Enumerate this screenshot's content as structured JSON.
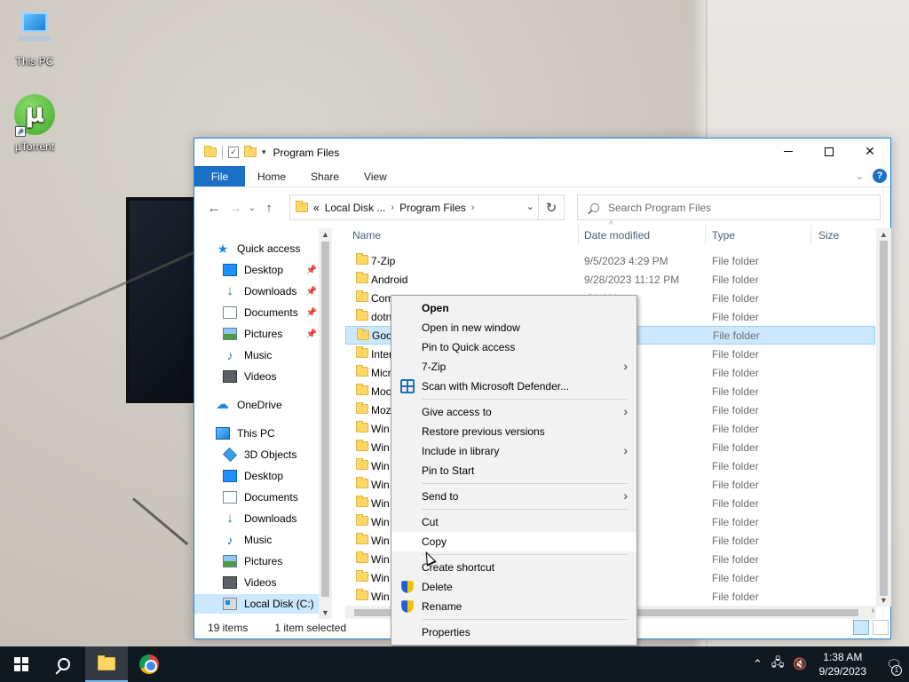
{
  "desktop": {
    "icons": [
      {
        "label": "This PC",
        "icon": "this-pc-icon"
      },
      {
        "label": "µTorrent",
        "icon": "utorrent-icon",
        "glyph": "µ"
      }
    ]
  },
  "window": {
    "title": "Program Files",
    "controls": {
      "minimize": "—",
      "maximize": "",
      "close": "✕"
    },
    "ribbon": {
      "file": "File",
      "tabs": [
        "Home",
        "Share",
        "View"
      ],
      "help": "?"
    },
    "address": {
      "prefix": "«",
      "crumbs": [
        "Local Disk ...",
        "Program Files"
      ]
    },
    "search": {
      "placeholder": "Search Program Files"
    },
    "nav": {
      "quick_access": "Quick access",
      "quick_items": [
        "Desktop",
        "Downloads",
        "Documents",
        "Pictures",
        "Music",
        "Videos"
      ],
      "onedrive": "OneDrive",
      "this_pc": "This PC",
      "pc_items": [
        "3D Objects",
        "Desktop",
        "Documents",
        "Downloads",
        "Music",
        "Pictures",
        "Videos",
        "Local Disk (C:)"
      ]
    },
    "columns": {
      "name": "Name",
      "date": "Date modified",
      "type": "Type",
      "size": "Size"
    },
    "files": [
      {
        "name": "7-Zip",
        "date": "9/5/2023 4:29 PM",
        "type": "File folder"
      },
      {
        "name": "Android",
        "date": "9/28/2023 11:12 PM",
        "type": "File folder"
      },
      {
        "name": "Com",
        "date": ":31 AM",
        "type": "File folder"
      },
      {
        "name": "dotn",
        "date": ":19 PM",
        "type": "File folder"
      },
      {
        "name": "Goo",
        "date": "28 PM",
        "type": "File folder"
      },
      {
        "name": "Inter",
        "date": "58 PM",
        "type": "File folder"
      },
      {
        "name": "Micr",
        "date": ":08 PM",
        "type": "File folder"
      },
      {
        "name": "Moc",
        "date": "14 AM",
        "type": "File folder"
      },
      {
        "name": "Moz",
        "date": "27 PM",
        "type": "File folder"
      },
      {
        "name": "Win",
        "date": "27 PM",
        "type": "File folder"
      },
      {
        "name": "Win",
        "date": "2:28 AM",
        "type": "File folder"
      },
      {
        "name": "Win",
        "date": "58 PM",
        "type": "File folder"
      },
      {
        "name": "Win",
        "date": "58 PM",
        "type": "File folder"
      },
      {
        "name": "Win",
        "date": "54 AM",
        "type": "File folder"
      },
      {
        "name": "Win",
        "date": "50 AM",
        "type": "File folder"
      },
      {
        "name": "Win",
        "date": "58 PM",
        "type": "File folder"
      },
      {
        "name": "Win",
        "date": "54 AM",
        "type": "File folder"
      },
      {
        "name": "Win",
        "date": "31 AM",
        "type": "File folder"
      },
      {
        "name": "Win",
        "date": "31 AM",
        "type": "File folder"
      }
    ],
    "selected_index": 4,
    "status": {
      "count": "19 items",
      "selected": "1 item selected"
    }
  },
  "context_menu": {
    "groups": [
      [
        {
          "label": "Open",
          "bold": true
        },
        {
          "label": "Open in new window"
        },
        {
          "label": "Pin to Quick access"
        },
        {
          "label": "7-Zip",
          "submenu": true
        },
        {
          "label": "Scan with Microsoft Defender...",
          "icon": "defender-icon"
        }
      ],
      [
        {
          "label": "Give access to",
          "submenu": true
        },
        {
          "label": "Restore previous versions"
        },
        {
          "label": "Include in library",
          "submenu": true
        },
        {
          "label": "Pin to Start"
        }
      ],
      [
        {
          "label": "Send to",
          "submenu": true
        }
      ],
      [
        {
          "label": "Cut"
        },
        {
          "label": "Copy",
          "hover": true
        }
      ],
      [
        {
          "label": "Create shortcut"
        },
        {
          "label": "Delete",
          "icon": "shield-icon"
        },
        {
          "label": "Rename",
          "icon": "shield-icon"
        }
      ],
      [
        {
          "label": "Properties"
        }
      ]
    ]
  },
  "taskbar": {
    "time": "1:38 AM",
    "date": "9/29/2023",
    "notification_count": "1"
  },
  "colors": {
    "accent": "#1a6fc6",
    "selection": "#cce8ff",
    "taskbar": "#101820",
    "folder": "#ffd766"
  }
}
